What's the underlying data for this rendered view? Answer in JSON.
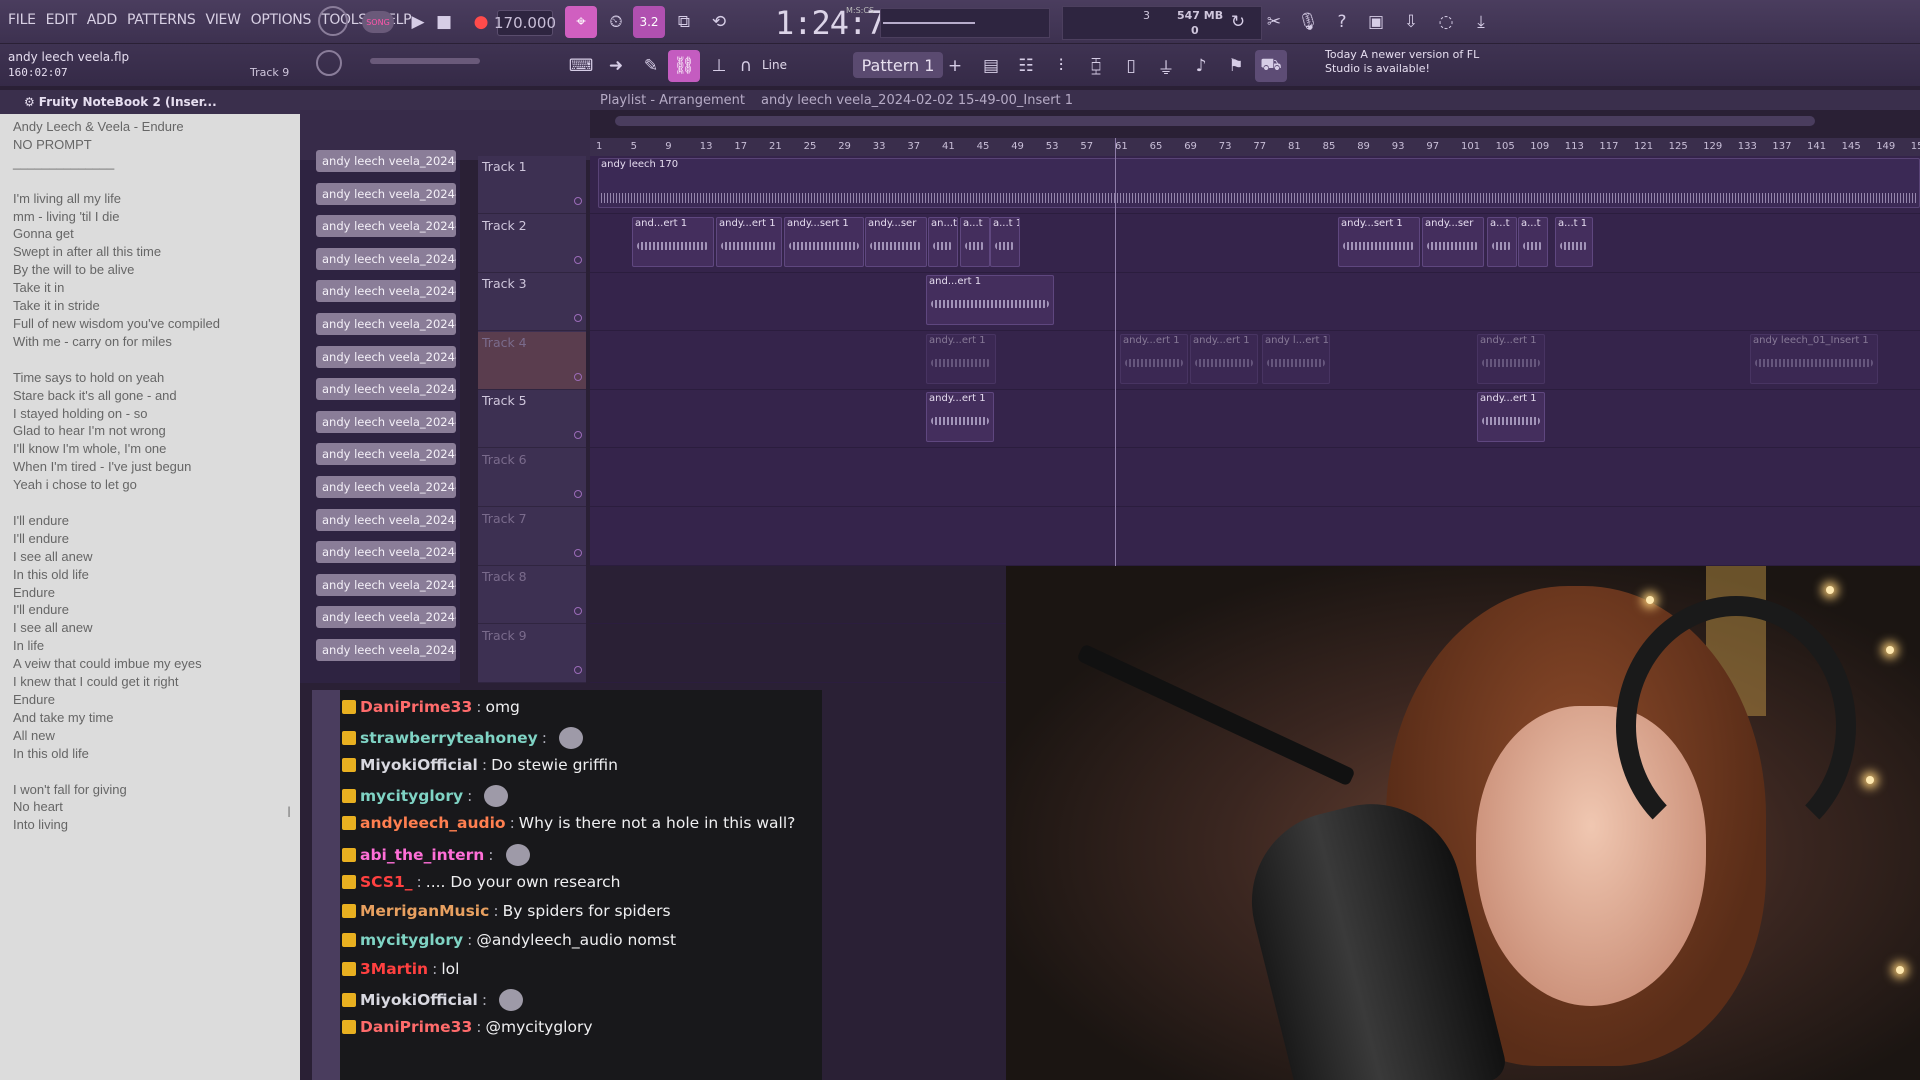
{
  "menu": [
    "FILE",
    "EDIT",
    "ADD",
    "PATTERNS",
    "VIEW",
    "OPTIONS",
    "TOOLS",
    "HELP"
  ],
  "transport": {
    "song_label": "SONG",
    "tempo": "170.000",
    "time": "1:24:70",
    "time_unit": "M:S:CS",
    "cpu_num": "3",
    "memory": "547 MB",
    "voices": "0"
  },
  "project": {
    "name": "andy leech veela.flp",
    "time": "160:02:07",
    "track": "Track 9"
  },
  "toolbar": {
    "snap": "Line",
    "pattern": "Pattern 1",
    "news_date": "Today",
    "news_text": "A newer version of FL Studio is available!"
  },
  "notebook": {
    "title": "Fruity NoteBook 2 (Inser...",
    "text": "Andy Leech & Veela - Endure\nNO PROMPT\n______________\n\nI'm living all my life\nmm - living 'til I die\nGonna get\nSwept in after all this time\nBy the will to be alive\nTake it in\nTake it in stride\nFull of new wisdom you've compiled\nWith me - carry on for miles\n\nTime says to hold on yeah\nStare back it's all gone - and\nI stayed holding on - so\nGlad to hear I'm not wrong\nI'll know I'm whole, I'm one\nWhen I'm tired - I've just begun\nYeah i chose to let go\n\nI'll endure\nI'll endure\nI see all anew\nIn this old life\nEndure\nI'll endure\nI see all anew\nIn life\nA veiw that could imbue my eyes\nI knew that I could get it right\nEndure\nAnd take my time\nAll new\nIn this old life\n\nI won't fall for giving\nNo heart\nInto living"
  },
  "playlist": {
    "title": "Playlist - Arrangement",
    "file": "andy leech veela_2024-02-02 15-49-00_Insert 1",
    "ruler": [
      "1",
      "5",
      "9",
      "13",
      "17",
      "21",
      "25",
      "29",
      "33",
      "37",
      "41",
      "45",
      "49",
      "53",
      "57",
      "61",
      "65",
      "69",
      "73",
      "77",
      "81",
      "85",
      "89",
      "93",
      "97",
      "101",
      "105",
      "109",
      "113",
      "117",
      "121",
      "125",
      "129",
      "133",
      "137",
      "141",
      "145",
      "149",
      "15"
    ],
    "channels": [
      "andy leech veela_2024-0...",
      "andy leech veela_2024-0...",
      "andy leech veela_2024-0...",
      "andy leech veela_2024-0...",
      "andy leech veela_2024-0...",
      "andy leech veela_2024-0...",
      "andy leech veela_2024-0...",
      "andy leech veela_2024-0...",
      "andy leech veela_2024-0...",
      "andy leech veela_2024-0...",
      "andy leech veela_2024-0...",
      "andy leech veela_2024-0...",
      "andy leech veela_2024-0...",
      "andy leech veela_2024-0...",
      "andy leech veela_2024-0...",
      "andy leech veela_2024-0..."
    ],
    "tracks": [
      "Track 1",
      "Track 2",
      "Track 3",
      "Track 4",
      "Track 5",
      "Track 6",
      "Track 7",
      "Track 8",
      "Track 9"
    ],
    "clip_main": "andy leech 170",
    "clips_t2": [
      "and...ert 1",
      "andy...ert 1",
      "andy...sert 1",
      "andy...ser",
      "an...t",
      "a...t",
      "a...t 1",
      "andy...sert 1",
      "andy...ser",
      "a...t",
      "a...t",
      "a...t 1"
    ],
    "clips_t3": [
      "and...ert 1"
    ],
    "clips_t4": [
      "andy...ert 1",
      "andy...ert 1",
      "andy...ert 1",
      "andy l...ert 1",
      "andy...ert 1",
      "andy leech_01_Insert 1"
    ],
    "clips_t5": [
      "andy...ert 1",
      "andy...ert 1"
    ]
  },
  "chat": [
    {
      "user": "DaniPrime33",
      "color": "#ff6b6b",
      "text": "omg"
    },
    {
      "user": "strawberryteahoney",
      "color": "#7fd3c4",
      "text": ""
    },
    {
      "user": "MiyokiOfficial",
      "color": "#d8d8e0",
      "text": "Do stewie griffin"
    },
    {
      "user": "mycityglory",
      "color": "#7fd3c4",
      "text": ""
    },
    {
      "user": "andyleech_audio",
      "color": "#ff7f50",
      "text": "Why is there not a hole in this wall?"
    },
    {
      "user": "abi_the_intern",
      "color": "#ff6fd8",
      "text": ""
    },
    {
      "user": "SCS1_",
      "color": "#ff4040",
      "text": ".... Do your own research"
    },
    {
      "user": "MerriganMusic",
      "color": "#e8a060",
      "text": "By spiders for spiders"
    },
    {
      "user": "mycityglory",
      "color": "#7fd3c4",
      "text": "@andyleech_audio nomst"
    },
    {
      "user": "3Martin",
      "color": "#ff4040",
      "text": "lol"
    },
    {
      "user": "MiyokiOfficial",
      "color": "#d8d8e0",
      "text": ""
    },
    {
      "user": "DaniPrime33",
      "color": "#ff6b6b",
      "text": "@mycityglory"
    }
  ]
}
